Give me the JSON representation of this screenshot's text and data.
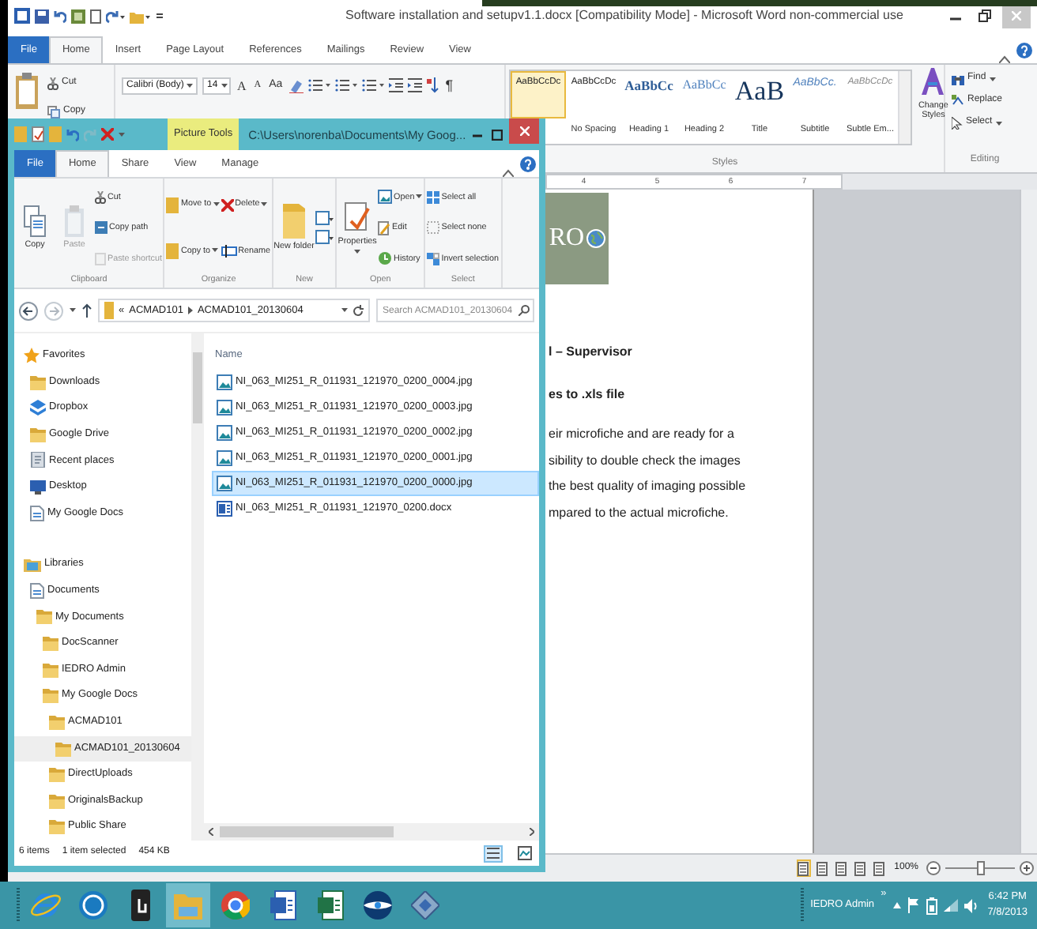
{
  "word": {
    "title": "Software installation and setupv1.1.docx [Compatibility Mode] - Microsoft Word non-commercial use",
    "tabs": [
      {
        "label": "File",
        "kind": "file",
        "selected": false
      },
      {
        "label": "Home",
        "kind": "tab",
        "selected": true
      },
      {
        "label": "Insert",
        "kind": "tab",
        "selected": false
      },
      {
        "label": "Page Layout",
        "kind": "tab",
        "selected": false
      },
      {
        "label": "References",
        "kind": "tab",
        "selected": false
      },
      {
        "label": "Mailings",
        "kind": "tab",
        "selected": false
      },
      {
        "label": "Review",
        "kind": "tab",
        "selected": false
      },
      {
        "label": "View",
        "kind": "tab",
        "selected": false
      }
    ],
    "clipboard": [
      "Cut",
      "Copy"
    ],
    "font": {
      "name": "Calibri (Body)",
      "size": "14",
      "grow": "A",
      "shrink": "A",
      "case": "Aa",
      "pilcrow": "¶"
    },
    "styles": [
      {
        "sample": "AaBbCcDc",
        "kind": "normal",
        "selected": true
      },
      {
        "sample": "AaBbCcDc",
        "label": "No Spacing",
        "kind": "normal",
        "selected": false
      },
      {
        "sample": "AaBbCc",
        "label": "Heading 1",
        "kind": "heading1",
        "selected": false
      },
      {
        "sample": "AaBbCc",
        "label": "Heading 2",
        "kind": "heading2",
        "selected": false
      },
      {
        "sample": "AaB",
        "label": "Title",
        "kind": "title",
        "selected": false
      },
      {
        "sample": "AaBbCc.",
        "label": "Subtitle",
        "kind": "subtitle",
        "selected": false
      },
      {
        "sample": "AaBbCcDc",
        "label": "Subtle Em...",
        "kind": "subtle",
        "selected": false
      }
    ],
    "change_styles": "Change Styles",
    "editing": [
      "Find",
      "Replace",
      "Select"
    ],
    "group_labels": [
      "Styles",
      "Editing"
    ],
    "ruler": [
      "4",
      "5",
      "6",
      "7"
    ],
    "document": {
      "logo_text": "RO",
      "headings": [
        "l – Supervisor",
        "es to .xls file"
      ],
      "lines": [
        "eir microfiche and are ready for a",
        "sibility to double check the images",
        "the best quality of imaging possible",
        "mpared to the actual microfiche."
      ]
    },
    "status": {
      "views": [
        {
          "selected": true
        },
        {
          "selected": false
        },
        {
          "selected": false
        },
        {
          "selected": false
        },
        {
          "selected": false
        }
      ],
      "zoom": "100%",
      "level": 0.5
    }
  },
  "explorer": {
    "context_tab": "Picture Tools",
    "path": "C:\\Users\\norenba\\Documents\\My Goog...",
    "tabs": [
      {
        "label": "File",
        "kind": "file",
        "selected": false
      },
      {
        "label": "Home",
        "kind": "tab",
        "selected": true
      },
      {
        "label": "Share",
        "kind": "tab",
        "selected": false
      },
      {
        "label": "View",
        "kind": "tab",
        "selected": false
      },
      {
        "label": "Manage",
        "kind": "tab",
        "selected": false
      }
    ],
    "ribbon": [
      {
        "label": "Clipboard",
        "columns": [
          [
            {
              "label": "Copy",
              "kind": "large",
              "disabled": false
            }
          ],
          [
            {
              "label": "Paste",
              "kind": "large",
              "disabled": true
            }
          ],
          [
            {
              "label": "Cut",
              "kind": "small",
              "disabled": false
            },
            {
              "label": "Copy path",
              "kind": "small",
              "disabled": false
            },
            {
              "label": "Paste shortcut",
              "kind": "small",
              "disabled": true
            }
          ]
        ]
      },
      {
        "label": "Organize",
        "columns": [
          [
            {
              "label": "Move to",
              "kind": "pair",
              "disabled": false,
              "dropdown": true
            },
            {
              "label": "Copy to",
              "kind": "pair",
              "disabled": false,
              "dropdown": true
            }
          ],
          [
            {
              "label": "Delete",
              "kind": "pair",
              "disabled": false,
              "dropdown": true
            },
            {
              "label": "Rename",
              "kind": "pair",
              "disabled": false
            }
          ]
        ]
      },
      {
        "label": "New",
        "columns": [
          [
            {
              "label": "New folder",
              "kind": "large",
              "disabled": false
            }
          ],
          [
            {
              "kind": "icons",
              "disabled": false
            }
          ]
        ]
      },
      {
        "label": "Open",
        "columns": [
          [
            {
              "label": "Properties",
              "kind": "large",
              "disabled": false,
              "dropdown": true
            }
          ],
          [
            {
              "label": "Open",
              "kind": "small",
              "disabled": false,
              "dropdown": true
            },
            {
              "label": "Edit",
              "kind": "small",
              "disabled": false
            },
            {
              "label": "History",
              "kind": "small",
              "disabled": false
            }
          ]
        ]
      },
      {
        "label": "Select",
        "columns": [
          [
            {
              "label": "Select all",
              "kind": "small",
              "disabled": false
            },
            {
              "label": "Select none",
              "kind": "small",
              "disabled": false
            },
            {
              "label": "Invert selection",
              "kind": "small",
              "disabled": false
            }
          ]
        ]
      }
    ],
    "address": {
      "overflow": "«",
      "crumbs": [
        "ACMAD101",
        "ACMAD101_20130604"
      ]
    },
    "search": {
      "placeholder": "Search ACMAD101_20130604"
    },
    "column": "Name",
    "tree": [
      {
        "label": "Favorites",
        "kind": "star",
        "selected": false,
        "children": [
          {
            "label": "Downloads",
            "kind": "folder",
            "selected": false
          },
          {
            "label": "Dropbox",
            "kind": "box",
            "selected": false
          },
          {
            "label": "Google Drive",
            "kind": "folder",
            "selected": false
          },
          {
            "label": "Recent places",
            "kind": "recent",
            "selected": false
          },
          {
            "label": "Desktop",
            "kind": "desktop",
            "selected": false
          },
          {
            "label": "My Google Docs",
            "kind": "page",
            "selected": false
          }
        ]
      },
      {
        "label": "Libraries",
        "kind": "library",
        "selected": false,
        "children": [
          {
            "label": "Documents",
            "kind": "page",
            "selected": false,
            "children": [
              {
                "label": "My Documents",
                "kind": "folder",
                "selected": false,
                "children": [
                  {
                    "label": "DocScanner",
                    "kind": "folder",
                    "selected": false
                  },
                  {
                    "label": "IEDRO Admin",
                    "kind": "folder",
                    "selected": false
                  },
                  {
                    "label": "My Google Docs",
                    "kind": "folder",
                    "selected": false,
                    "children": [
                      {
                        "label": "ACMAD101",
                        "kind": "folder",
                        "selected": false,
                        "children": [
                          {
                            "label": "ACMAD101_20130604",
                            "kind": "folder",
                            "selected": true
                          }
                        ]
                      },
                      {
                        "label": "DirectUploads",
                        "kind": "folder",
                        "selected": false
                      },
                      {
                        "label": "OriginalsBackup",
                        "kind": "folder",
                        "selected": false
                      },
                      {
                        "label": "Public Share",
                        "kind": "folder",
                        "selected": false
                      }
                    ]
                  }
                ]
              }
            ]
          }
        ]
      }
    ],
    "files": [
      {
        "name": "NI_063_MI251_R_011931_121970_0200_0004.jpg",
        "kind": "image",
        "selected": false
      },
      {
        "name": "NI_063_MI251_R_011931_121970_0200_0003.jpg",
        "kind": "image",
        "selected": false
      },
      {
        "name": "NI_063_MI251_R_011931_121970_0200_0002.jpg",
        "kind": "image",
        "selected": false
      },
      {
        "name": "NI_063_MI251_R_011931_121970_0200_0001.jpg",
        "kind": "image",
        "selected": false
      },
      {
        "name": "NI_063_MI251_R_011931_121970_0200_0000.jpg",
        "kind": "image",
        "selected": true
      },
      {
        "name": "NI_063_MI251_R_011931_121970_0200.docx",
        "kind": "document",
        "selected": false
      }
    ],
    "status": {
      "count": "6 items",
      "selection": "1 item selected",
      "size": "454 KB",
      "views": [
        {
          "selected": true
        },
        {
          "selected": false
        }
      ]
    }
  },
  "taskbar": {
    "apps": [
      {
        "active": false
      },
      {
        "active": false
      },
      {
        "active": false
      },
      {
        "active": true
      },
      {
        "active": false
      },
      {
        "active": false
      },
      {
        "active": false
      },
      {
        "active": false
      },
      {
        "active": false
      }
    ],
    "user": "IEDRO Admin",
    "overflow": "»",
    "time": "6:42 PM",
    "date": "7/8/2013"
  }
}
